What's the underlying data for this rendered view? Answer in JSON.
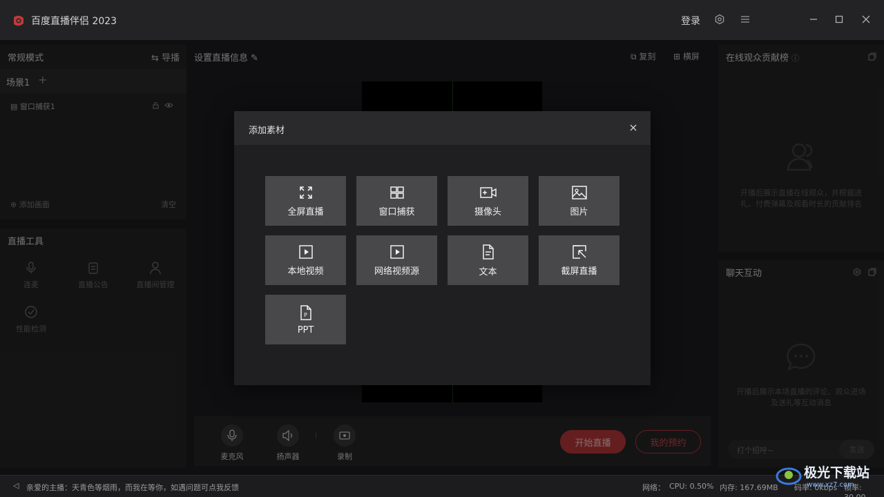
{
  "app": {
    "title": "百度直播伴侣 2023",
    "brand_color": "#b8373a"
  },
  "titlebar": {
    "login": "登录",
    "icons": [
      "settings-icon",
      "menu-icon",
      "minimize-icon",
      "maximize-icon",
      "close-icon"
    ]
  },
  "left": {
    "mode": "常规模式",
    "guide": "导播",
    "scene_tab": "场景1",
    "source_item": "窗口捕获1",
    "add_scene": "添加画面",
    "clear": "清空",
    "tools_title": "直播工具",
    "tools": [
      {
        "label": "连麦",
        "icon": "mic-icon"
      },
      {
        "label": "直播公告",
        "icon": "notice-icon"
      },
      {
        "label": "直播间管理",
        "icon": "user-icon"
      },
      {
        "label": "性能检测",
        "icon": "performance-icon"
      }
    ]
  },
  "center": {
    "info_title": "设置直播信息",
    "copy": "复刻",
    "landscape": "横屏",
    "bottom": {
      "mic": "麦克风",
      "speaker": "扬声器",
      "record": "录制",
      "start": "开始直播",
      "reservation": "我的预约"
    }
  },
  "right": {
    "contrib_title": "在线观众贡献榜",
    "contrib_hint": "开播后展示直播在线观众，并根据送礼、付费弹幕及观看时长的贡献排名",
    "chat_title": "聊天互动",
    "chat_hint": "开播后展示本场直播的评论、观众进场及送礼等互动消息",
    "chat_placeholder": "打个招呼~",
    "send": "发送"
  },
  "status": {
    "tip": "亲爱的主播：天青色等烟雨，而我在等你，如遇问题可点我反馈",
    "network": "网络：",
    "cpu": "CPU: 0.50%",
    "memory": "内存: 167.69MB",
    "bitrate": "码率: 0kbps",
    "fps": "帧率: 30.00"
  },
  "modal": {
    "title": "添加素材",
    "tiles": [
      {
        "label": "全屏直播",
        "icon": "fullscreen-icon"
      },
      {
        "label": "窗口捕获",
        "icon": "window-icon"
      },
      {
        "label": "摄像头",
        "icon": "camera-icon"
      },
      {
        "label": "图片",
        "icon": "image-icon"
      },
      {
        "label": "本地视频",
        "icon": "local-video-icon"
      },
      {
        "label": "网络视频源",
        "icon": "network-video-icon"
      },
      {
        "label": "文本",
        "icon": "text-icon"
      },
      {
        "label": "截屏直播",
        "icon": "screenshot-icon"
      },
      {
        "label": "PPT",
        "icon": "ppt-icon"
      }
    ]
  },
  "watermark": {
    "text": "极光下载站",
    "sub": "www.xz7.com"
  }
}
